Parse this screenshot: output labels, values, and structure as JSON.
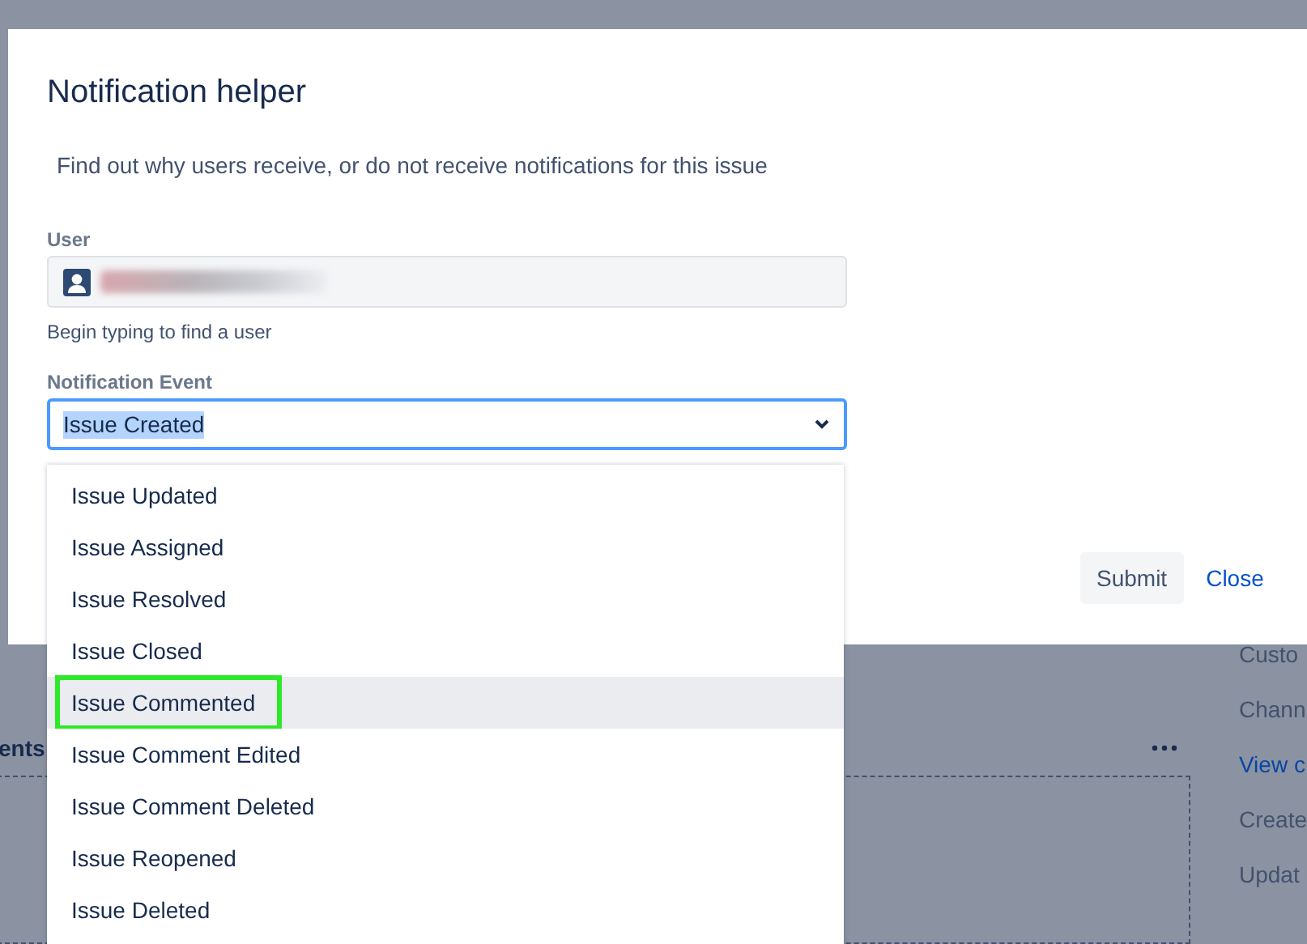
{
  "background": {
    "section_heading": "ents",
    "side_fields": [
      {
        "text": "Custo",
        "kind": "label"
      },
      {
        "text": "Chann",
        "kind": "label"
      },
      {
        "text": "View c",
        "kind": "link"
      },
      {
        "text": "Create",
        "kind": "label"
      },
      {
        "text": "Updat",
        "kind": "label"
      }
    ]
  },
  "dialog": {
    "title": "Notification helper",
    "description": "Find out why users receive, or do not receive notifications for this issue",
    "user": {
      "label": "User",
      "value_redacted": true,
      "help": "Begin typing to find a user"
    },
    "event": {
      "label": "Notification Event",
      "value": "Issue Created",
      "value_highlighted": true,
      "expanded": true,
      "options": [
        {
          "label": "Issue Updated",
          "highlighted": false,
          "annotated": false
        },
        {
          "label": "Issue Assigned",
          "highlighted": false,
          "annotated": false
        },
        {
          "label": "Issue Resolved",
          "highlighted": false,
          "annotated": false
        },
        {
          "label": "Issue Closed",
          "highlighted": false,
          "annotated": false
        },
        {
          "label": "Issue Commented",
          "highlighted": true,
          "annotated": true
        },
        {
          "label": "Issue Comment Edited",
          "highlighted": false,
          "annotated": false
        },
        {
          "label": "Issue Comment Deleted",
          "highlighted": false,
          "annotated": false
        },
        {
          "label": "Issue Reopened",
          "highlighted": false,
          "annotated": false
        },
        {
          "label": "Issue Deleted",
          "highlighted": false,
          "annotated": false
        }
      ]
    },
    "buttons": [
      {
        "label": "Submit",
        "kind": "button"
      },
      {
        "label": "Close",
        "kind": "link"
      }
    ]
  }
}
